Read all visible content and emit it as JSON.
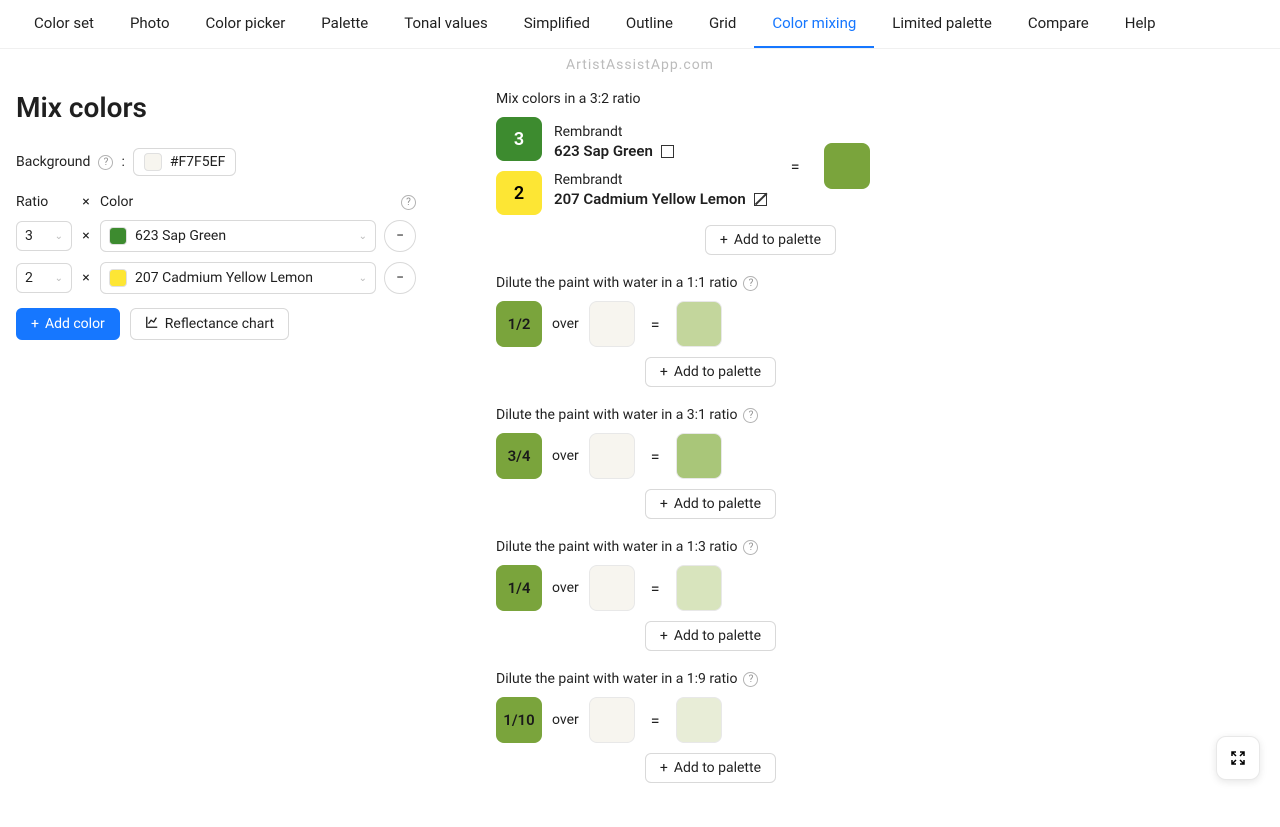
{
  "nav": {
    "items": [
      "Color set",
      "Photo",
      "Color picker",
      "Palette",
      "Tonal values",
      "Simplified",
      "Outline",
      "Grid",
      "Color mixing",
      "Limited palette",
      "Compare",
      "Help"
    ],
    "active": "Color mixing"
  },
  "watermark": "ArtistAssistApp.com",
  "page": {
    "title": "Mix colors"
  },
  "bg": {
    "label": "Background",
    "value": "#F7F5EF",
    "swatch": "#F7F5EF"
  },
  "headers": {
    "ratio": "Ratio",
    "x": "×",
    "color": "Color"
  },
  "rows": [
    {
      "ratio": "3",
      "swatch": "#3d8b2f",
      "name": "623 Sap Green"
    },
    {
      "ratio": "2",
      "swatch": "#fde634",
      "name": "207 Cadmium Yellow Lemon"
    }
  ],
  "buttons": {
    "add_color": "Add color",
    "reflectance": "Reflectance chart",
    "add_palette": "Add to palette"
  },
  "mix": {
    "heading": "Mix colors in a 3:2 ratio",
    "parts": [
      {
        "n": "3",
        "bg": "#3d8b2f",
        "fg": "#fff",
        "brand": "Rembrandt",
        "name": "623 Sap Green",
        "diag": false
      },
      {
        "n": "2",
        "bg": "#fde634",
        "fg": "#000",
        "brand": "Rembrandt",
        "name": "207 Cadmium Yellow Lemon",
        "diag": true
      }
    ],
    "result": "#7aa43c"
  },
  "dilutes": [
    {
      "text": "Dilute the paint with water in a 1:1 ratio",
      "label": "1/2",
      "chip": "#7aa43c",
      "over": "over",
      "base": "#F7F5EF",
      "result": "#c3d69c"
    },
    {
      "text": "Dilute the paint with water in a 3:1 ratio",
      "label": "3/4",
      "chip": "#7aa43c",
      "over": "over",
      "base": "#F7F5EF",
      "result": "#a9c679"
    },
    {
      "text": "Dilute the paint with water in a 1:3 ratio",
      "label": "1/4",
      "chip": "#7aa43c",
      "over": "over",
      "base": "#F7F5EF",
      "result": "#d8e4bd"
    },
    {
      "text": "Dilute the paint with water in a 1:9 ratio",
      "label": "1/10",
      "chip": "#7aa43c",
      "over": "over",
      "base": "#F7F5EF",
      "result": "#e8edd7"
    }
  ],
  "eq": "="
}
